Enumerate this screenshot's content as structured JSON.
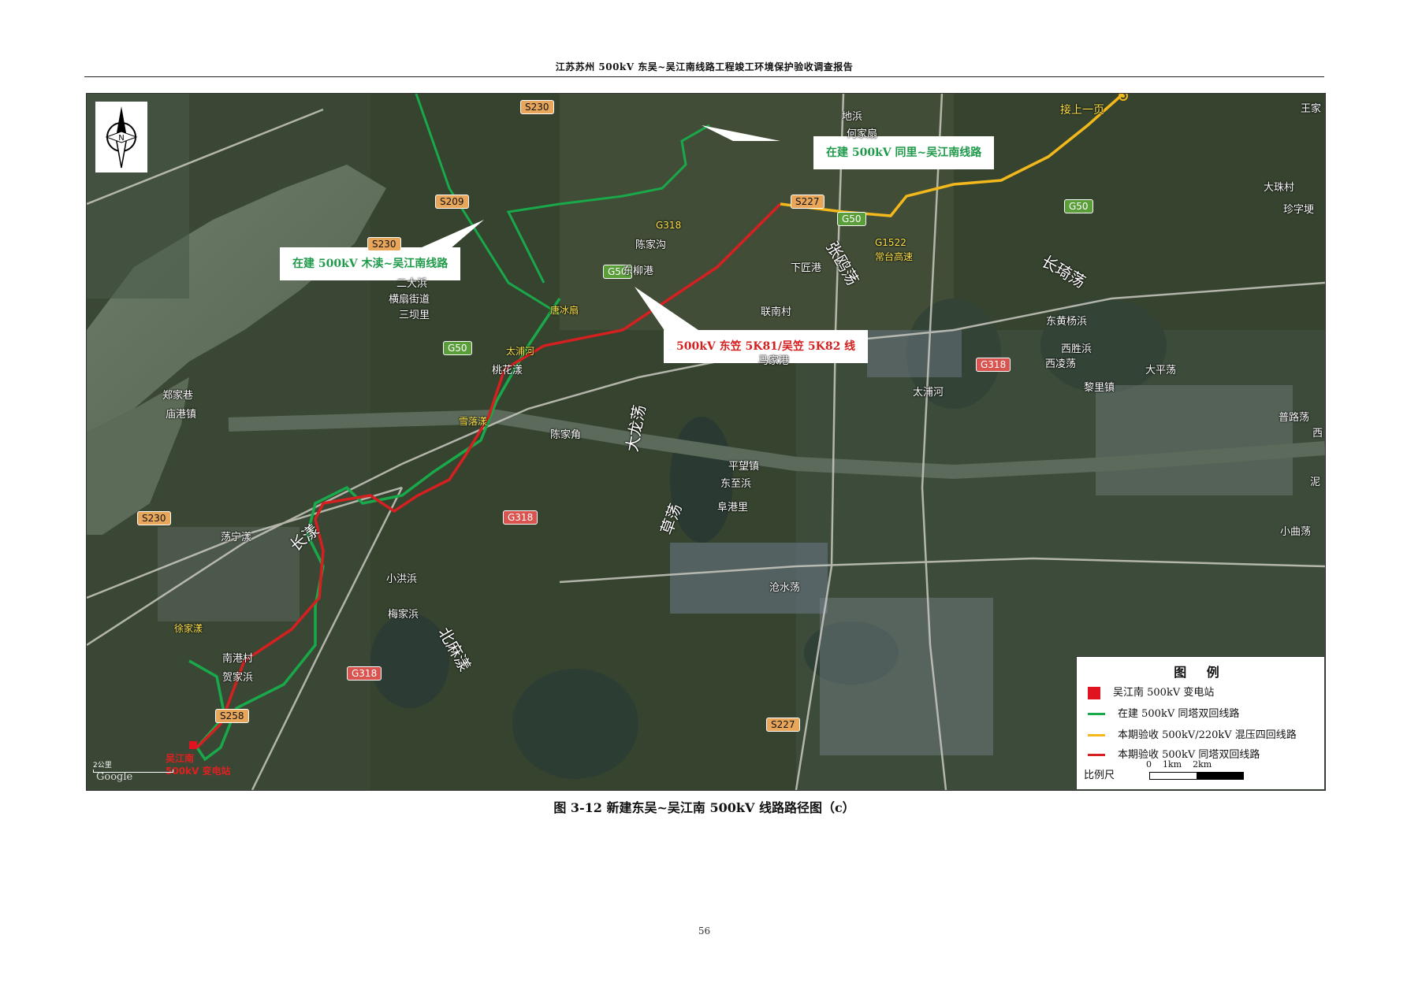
{
  "header": {
    "title": "江苏苏州 500kV 东吴~吴江南线路工程竣工环境保护验收调查报告"
  },
  "map": {
    "callouts": {
      "tongli": "在建 500kV 同里~吴江南线路",
      "mudu": "在建 500kV 木渎~吴江南线路",
      "line_5k81": "500kV 东笠 5K81/吴笠 5K82 线"
    },
    "continue_label": "接上一页",
    "roads": {
      "s230_top": "S230",
      "s209": "S209",
      "s230_mid": "S230",
      "s230_left": "S230",
      "s227_top": "S227",
      "s227_bottom": "S227",
      "s258": "S258",
      "g50_a": "G50",
      "g50_b": "G50",
      "g50_c": "G50",
      "g50_d": "G50",
      "g318_a": "G318",
      "g318_b": "G318",
      "g318_c": "G318"
    },
    "places": {
      "dibang": "地浜",
      "hejiaqu": "何家扇",
      "wangjia": "王家",
      "dazhucun": "大珠村",
      "zhenziqian": "珍字埂",
      "chenjiagou": "陈家沟",
      "dongliugang": "东柳港",
      "xiajianggang": "下匠港",
      "zhangoudang": "张鸥荡",
      "changqidang": "长琦荡",
      "erda": "二大浜",
      "hengshan": "横扇街道",
      "sanbali": "三坝里",
      "lianshangcun": "联南村",
      "dongyangbang": "东黄杨浜",
      "xishengbang": "西胜浜",
      "xilingdang": "西凌荡",
      "majiagang": "马家港",
      "taipudang": "大平荡",
      "lilizhen": "黎里镇",
      "taipuhe": "太浦河",
      "taohuadang": "桃花漾",
      "zhengjiaxiang": "郑家巷",
      "miaogangzhen": "庙港镇",
      "chenjiajiao": "陈家角",
      "dalongdang": "大龙荡",
      "pingwangzhen": "平望镇",
      "dongzhibang": "东至浜",
      "fugangli": "阜港里",
      "caodang": "草荡",
      "pululdang": "普路荡",
      "xi": "西",
      "nidang": "泥",
      "xiaoqudang": "小曲荡",
      "danningdang": "荡宁漾",
      "changdang": "长漾",
      "xiaohongbang": "小洪浜",
      "meijiabang": "梅家浜",
      "beimadang": "北麻漾",
      "cangshuidang": "沧水荡",
      "nangangcun": "南港村",
      "hejiabang": "贺家浜"
    },
    "yellow_labels": {
      "g318": "G318",
      "g1522": "G1522",
      "gaosu": "常台高速",
      "tangbinshan": "唐冰扇",
      "taipuhe": "太浦河",
      "xueluodang": "雪落漾",
      "xujiadang": "徐家漾"
    },
    "substation_label": [
      "吴江南",
      "500kV 变电站"
    ],
    "scale_mini": "2公里",
    "watermark": "Google"
  },
  "legend": {
    "title": "图 例",
    "items": [
      {
        "label": "吴江南 500kV 变电站",
        "color": "#e0141e",
        "shape": "square"
      },
      {
        "label": "在建 500kV 同塔双回线路",
        "color": "#19a84a",
        "shape": "line"
      },
      {
        "label": "本期验收 500kV/220kV 混压四回线路",
        "color": "#f2b81c",
        "shape": "line"
      },
      {
        "label": "本期验收 500kV 同塔双回线路",
        "color": "#d42020",
        "shape": "line"
      }
    ],
    "scale_label": "比例尺",
    "scale_ticks": "0    1km    2km"
  },
  "caption": "图 3-12   新建东吴~吴江南 500kV 线路路径图（c）",
  "page_number": "56"
}
